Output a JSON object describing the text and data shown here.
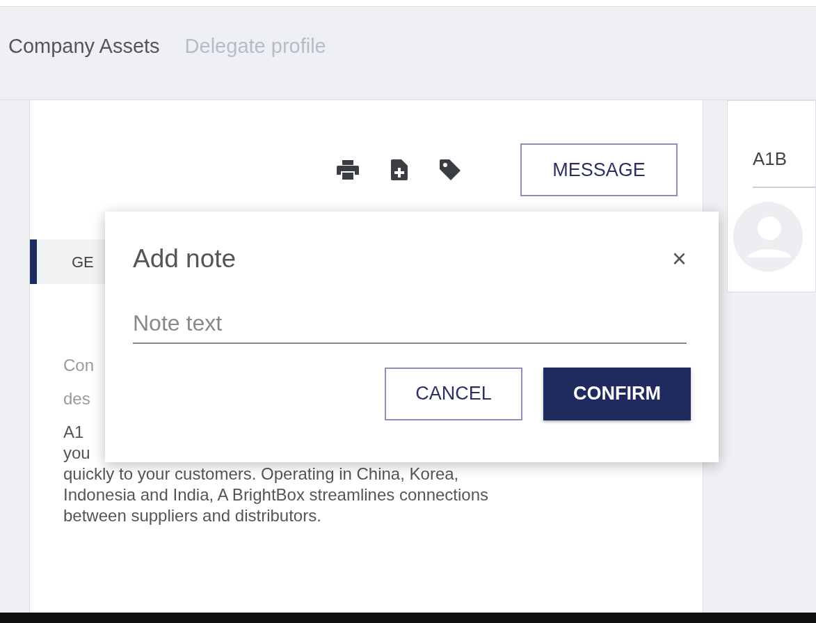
{
  "tabs": [
    {
      "label": "Company Assets",
      "selected": true
    },
    {
      "label": "Delegate profile",
      "selected": false
    }
  ],
  "toolbar": {
    "message_button": "MESSAGE"
  },
  "section_tab": {
    "label": "GE",
    "selected": true
  },
  "description": [
    {
      "text": "Con",
      "kind": "muted"
    },
    {
      "text": "des",
      "kind": "muted"
    },
    {
      "text": "A1",
      "kind": "body"
    },
    {
      "text": "you",
      "kind": "body"
    },
    {
      "text": "quickly to your customers. Operating in China, Korea,",
      "kind": "body"
    },
    {
      "text": "Indonesia and India, A BrightBox streamlines connections",
      "kind": "body"
    },
    {
      "text": "between suppliers and distributors.",
      "kind": "body"
    }
  ],
  "dialog": {
    "title": "Add note",
    "close": "×",
    "field": {
      "placeholder": "Note text"
    },
    "buttons": [
      {
        "label": "CANCEL",
        "kind": "outline"
      },
      {
        "label": "CONFIRM",
        "kind": "primary"
      }
    ]
  },
  "side_card": {
    "title": "A1B"
  }
}
